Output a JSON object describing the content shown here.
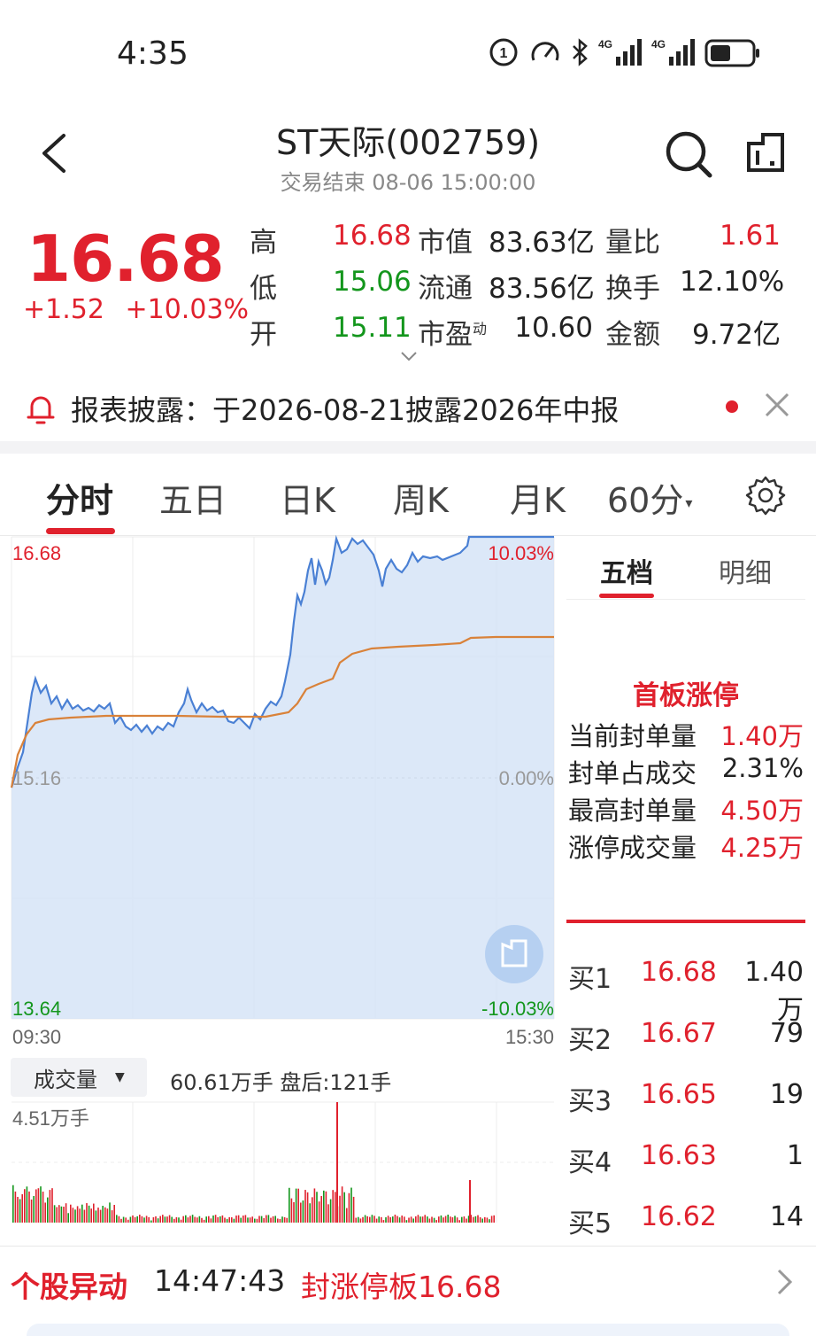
{
  "status": {
    "time": "4:35",
    "net1": "4G",
    "net2": "4G"
  },
  "header": {
    "title": "ST天际(002759)",
    "subtitle": "交易结束 08-06 15:00:00"
  },
  "quote": {
    "price": "16.68",
    "change": "+1.52",
    "change_pct": "+10.03%",
    "rows": [
      [
        {
          "l": "高",
          "v": "16.68",
          "c": "red"
        },
        {
          "l": "市值",
          "v": "83.63亿"
        },
        {
          "l": "量比",
          "v": "1.61",
          "c": "red"
        }
      ],
      [
        {
          "l": "低",
          "v": "15.06",
          "c": "green"
        },
        {
          "l": "流通",
          "v": "83.56亿"
        },
        {
          "l": "换手",
          "v": "12.10%"
        }
      ],
      [
        {
          "l": "开",
          "v": "15.11",
          "c": "green"
        },
        {
          "l": "市盈",
          "v": "10.60"
        },
        {
          "l": "金额",
          "v": "9.72亿"
        }
      ]
    ],
    "pe_sup": "动"
  },
  "notice": {
    "text": "报表披露：于2026-08-21披露2026年中报"
  },
  "tabs": [
    "分时",
    "五日",
    "日K",
    "周K",
    "月K",
    "60分"
  ],
  "chart": {
    "price_high": "16.68",
    "pct_high": "10.03%",
    "price_mid": "15.16",
    "pct_mid": "0.00%",
    "price_low": "13.64",
    "pct_low": "-10.03%",
    "time_start": "09:30",
    "time_end": "15:30",
    "colors": {
      "line": "#4a80d4",
      "avg": "#d9823a",
      "fill": "#d6e4f7",
      "up": "#e0212d",
      "down": "#13961c"
    }
  },
  "volume": {
    "button": "成交量",
    "info": "60.61万手 盘后:121手",
    "max": "4.51万手"
  },
  "panel": {
    "tab1": "五档",
    "tab2": "明细",
    "limit_title": "首板涨停",
    "limit_rows": [
      {
        "label": "当前封单量",
        "value": "1.40万",
        "c": "red"
      },
      {
        "label": "封单占成交",
        "value": "2.31%",
        "c": "dark"
      },
      {
        "label": "最高封单量",
        "value": "4.50万",
        "c": "red"
      },
      {
        "label": "涨停成交量",
        "value": "4.25万",
        "c": "red"
      }
    ],
    "bids": [
      {
        "name": "买1",
        "price": "16.68",
        "vol": "1.40万"
      },
      {
        "name": "买2",
        "price": "16.67",
        "vol": "79"
      },
      {
        "name": "买3",
        "price": "16.65",
        "vol": "19"
      },
      {
        "name": "买4",
        "price": "16.63",
        "vol": "1"
      },
      {
        "name": "买5",
        "price": "16.62",
        "vol": "14"
      }
    ]
  },
  "alert": {
    "label": "个股异动",
    "time": "14:47:43",
    "text": "封涨停板16.68"
  }
}
